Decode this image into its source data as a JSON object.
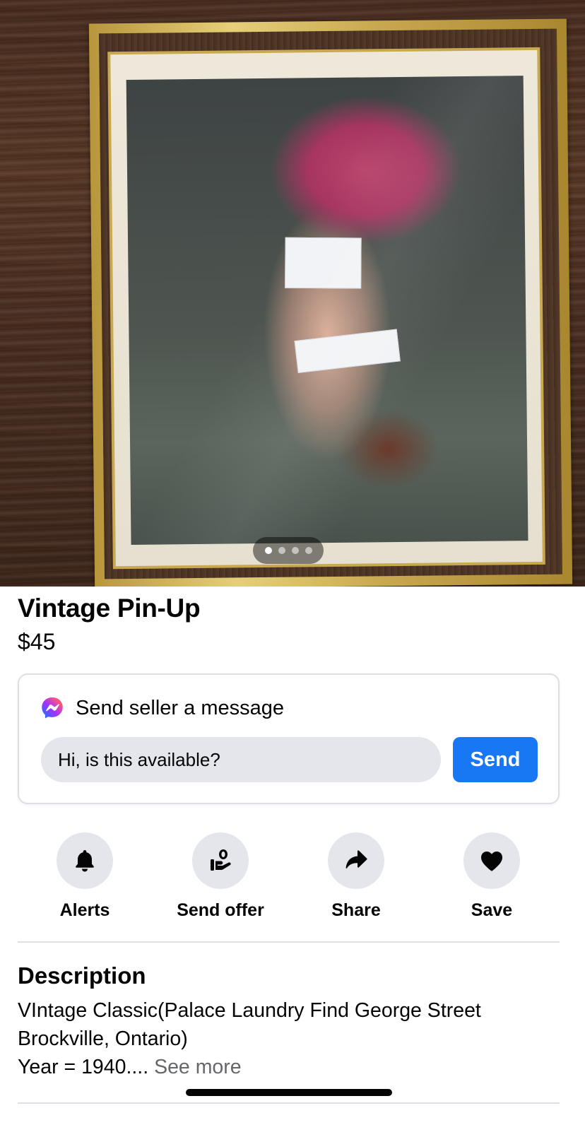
{
  "listing": {
    "photo": {
      "alt": "Framed vintage pin-up photograph",
      "pager": {
        "total": 4,
        "active_index": 0
      }
    },
    "title": "Vintage Pin-Up",
    "price": "$45"
  },
  "message_card": {
    "icon": "messenger-icon",
    "heading": "Send seller a message",
    "input_value": "Hi, is this available?",
    "send_label": "Send",
    "accent_color": "#1877f2"
  },
  "actions": [
    {
      "icon": "bell-icon",
      "label": "Alerts"
    },
    {
      "icon": "hand-coin-icon",
      "label": "Send offer"
    },
    {
      "icon": "share-arrow-icon",
      "label": "Share"
    },
    {
      "icon": "heart-icon",
      "label": "Save"
    }
  ],
  "description": {
    "heading": "Description",
    "lines": [
      "VIntage Classic(Palace Laundry Find George Street",
      "Brockville, Ontario)",
      "Year = 1940...."
    ],
    "see_more": "See more"
  }
}
